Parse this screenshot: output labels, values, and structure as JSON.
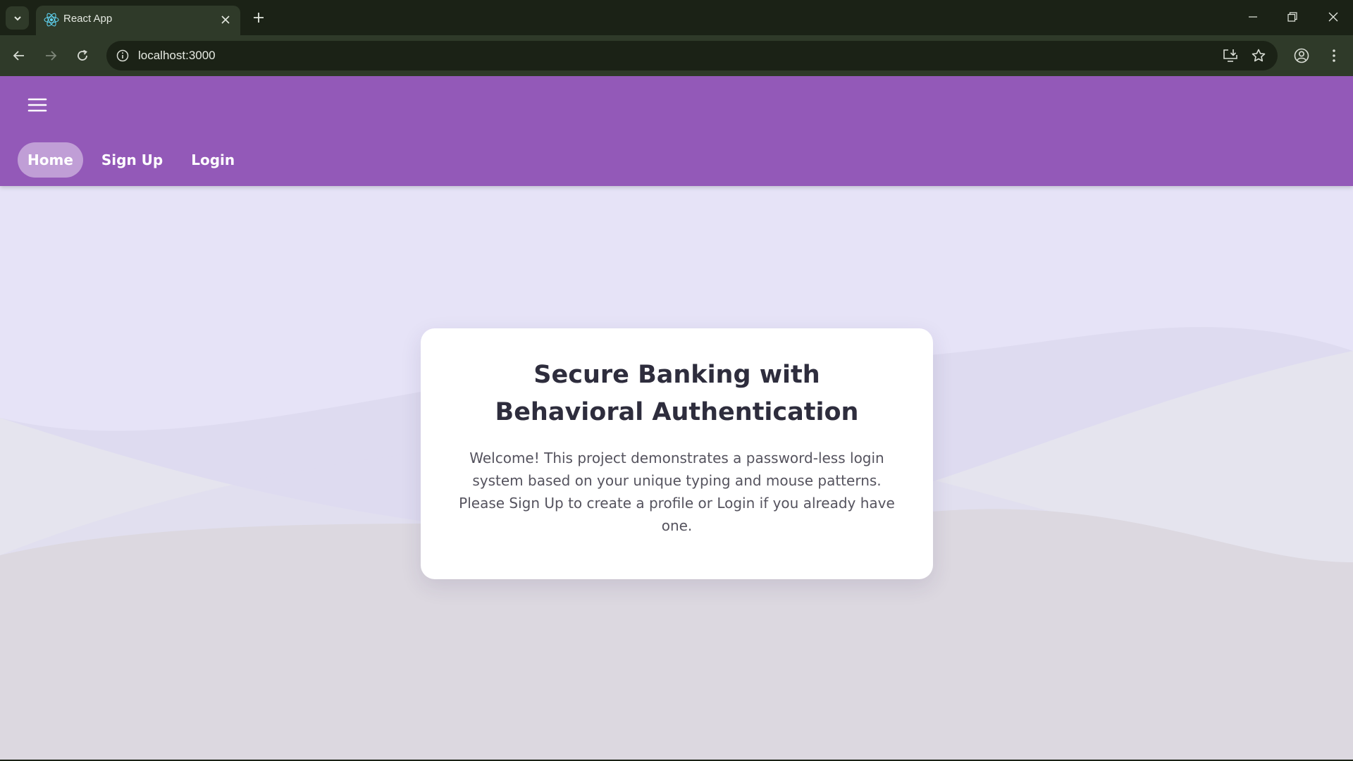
{
  "browser": {
    "tab_title": "React App",
    "url": "localhost:3000"
  },
  "nav": {
    "items": [
      {
        "label": "Home",
        "active": true
      },
      {
        "label": "Sign Up",
        "active": false
      },
      {
        "label": "Login",
        "active": false
      }
    ]
  },
  "hero": {
    "title": "Secure Banking with Behavioral Authentication",
    "body": "Welcome! This project demonstrates a password-less login system based on your unique typing and mouse patterns. Please Sign Up to create a profile or Login if you already have one."
  },
  "colors": {
    "appbar": "#9359b8",
    "page_background": "#e6e3f7",
    "browser_frame": "#1b2216",
    "browser_toolbar": "#2f3a29"
  },
  "icons": [
    "tab-search-icon",
    "react-favicon-icon",
    "close-icon",
    "plus-icon",
    "minimize-icon",
    "restore-icon",
    "back-arrow-icon",
    "forward-arrow-icon",
    "reload-icon",
    "info-icon",
    "install-app-icon",
    "star-icon",
    "profile-icon",
    "more-vert-icon",
    "hamburger-menu-icon"
  ]
}
